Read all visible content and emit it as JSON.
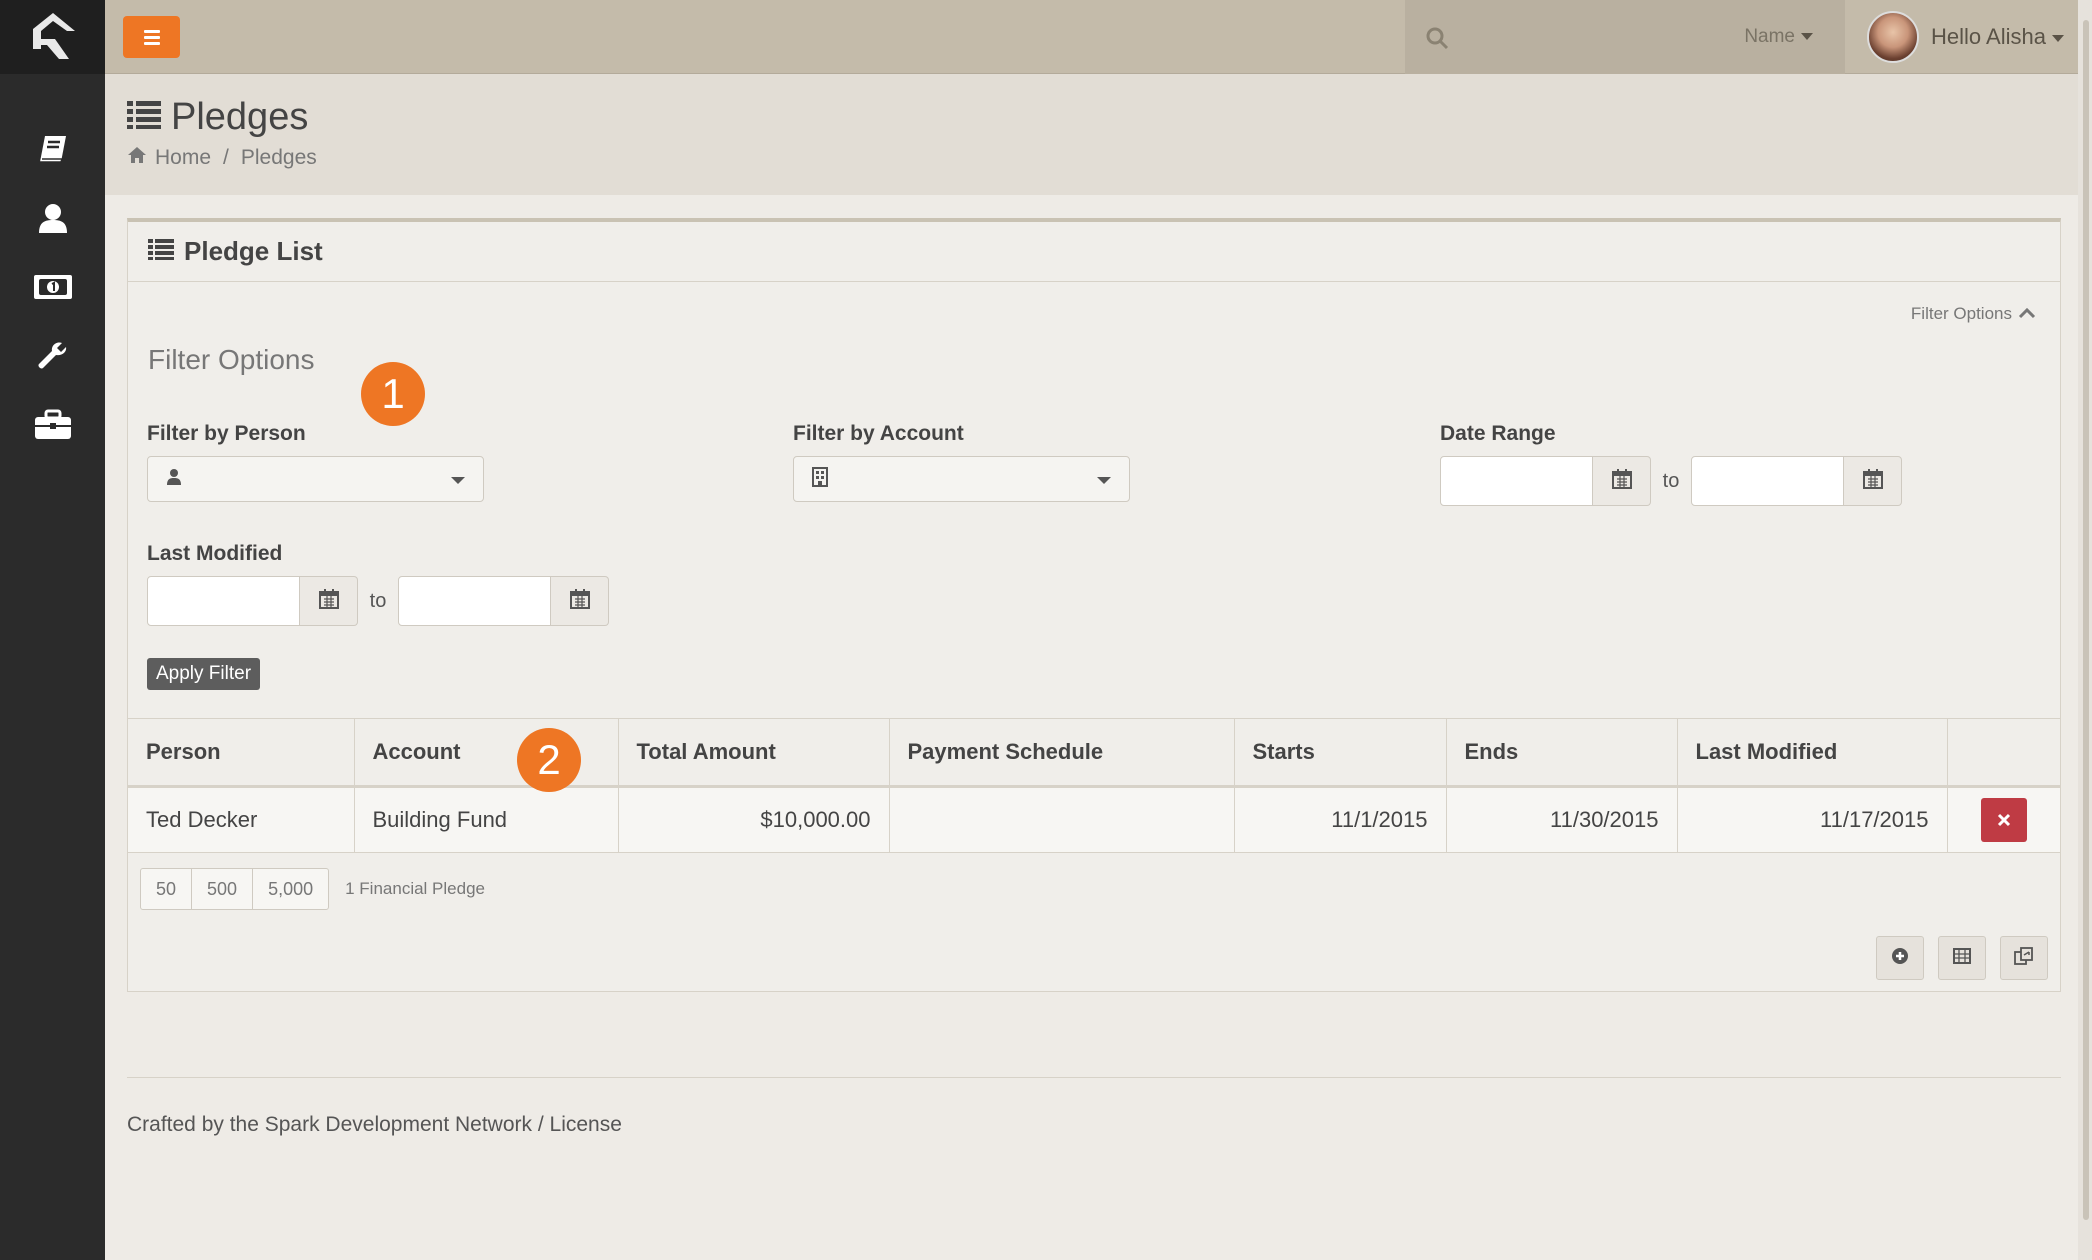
{
  "topbar": {
    "search_type": "Name",
    "greeting": "Hello Alisha"
  },
  "sidebar": {
    "items": [
      {
        "icon": "book-icon"
      },
      {
        "icon": "person-icon"
      },
      {
        "icon": "money-icon"
      },
      {
        "icon": "wrench-icon"
      },
      {
        "icon": "briefcase-icon"
      }
    ]
  },
  "page": {
    "title": "Pledges",
    "breadcrumb": {
      "home": "Home",
      "sep": "/",
      "current": "Pledges"
    }
  },
  "panel": {
    "title": "Pledge List",
    "filter_toggle": "Filter Options",
    "filter_title": "Filter Options",
    "badge1": "1",
    "badge2": "2",
    "filter_person_label": "Filter by Person",
    "filter_account_label": "Filter by Account",
    "date_range_label": "Date Range",
    "last_modified_label": "Last Modified",
    "to": "to",
    "apply_label": "Apply Filter"
  },
  "table": {
    "headers": {
      "person": "Person",
      "account": "Account",
      "total_amount": "Total Amount",
      "payment_schedule": "Payment Schedule",
      "starts": "Starts",
      "ends": "Ends",
      "last_modified": "Last Modified"
    },
    "rows": [
      {
        "person": "Ted Decker",
        "account": "Building Fund",
        "total_amount": "$10,000.00",
        "payment_schedule": "",
        "starts": "11/1/2015",
        "ends": "11/30/2015",
        "last_modified": "11/17/2015"
      }
    ]
  },
  "pager": {
    "sizes": [
      "50",
      "500",
      "5,000"
    ],
    "count": "1 Financial Pledge"
  },
  "footer": {
    "text": "Crafted by the Spark Development Network / License"
  },
  "colors": {
    "accent": "#ee7624",
    "danger": "#bf3b44",
    "sidebar": "#2b2b2b",
    "topbar": "#c4bbaa"
  }
}
